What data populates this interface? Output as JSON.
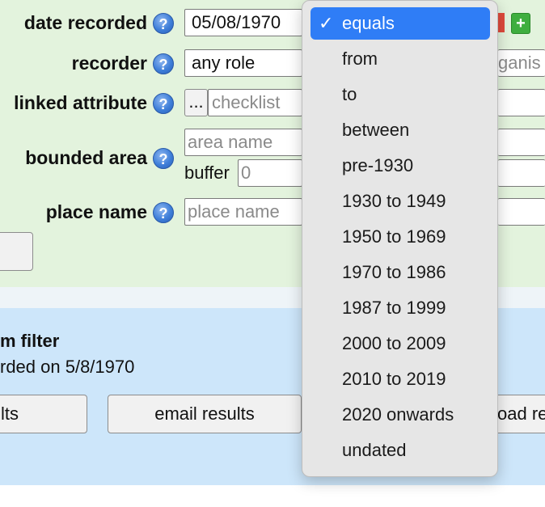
{
  "form": {
    "date_recorded": {
      "label": "date recorded",
      "value": "05/08/1970"
    },
    "recorder": {
      "label": "recorder",
      "value": "any role",
      "partial_right": "ganis"
    },
    "linked_attribute": {
      "label": "linked attribute",
      "ellipsis": "...",
      "placeholder": "checklist"
    },
    "bounded_area": {
      "label": "bounded area",
      "placeholder": "area name",
      "buffer_label": "buffer",
      "buffer_value": "0"
    },
    "place_name": {
      "label": "place name",
      "placeholder": "place name"
    }
  },
  "filter": {
    "title": "m filter",
    "description": "rded on 5/8/1970"
  },
  "results": {
    "buttons": [
      "lts",
      "email results",
      "oad re"
    ]
  },
  "dropdown": {
    "selected_index": 0,
    "check_mark": "✓",
    "options": [
      "equals",
      "from",
      "to",
      "between",
      "pre-1930",
      "1930 to 1949",
      "1950 to 1969",
      "1970 to 1986",
      "1987 to 1999",
      "2000 to 2009",
      "2010 to 2019",
      "2020 onwards",
      "undated"
    ]
  },
  "icons": {
    "help": "help-icon",
    "remove": "remove-icon",
    "add": "add-icon"
  },
  "colors": {
    "form_bg": "#e3f3dd",
    "results_bg": "#cde6fa",
    "dropdown_bg": "#e6e6e6",
    "selection": "#2f7df6"
  }
}
